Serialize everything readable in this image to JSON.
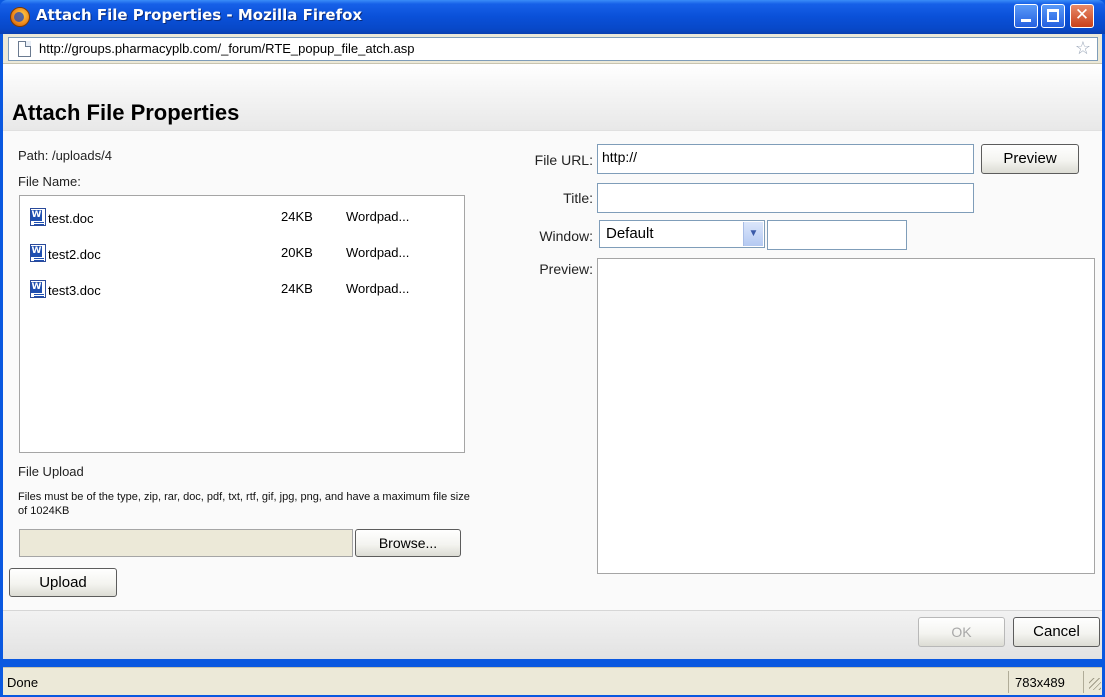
{
  "window": {
    "title": "Attach File Properties - Mozilla Firefox",
    "url": "http://groups.pharmacyplb.com/_forum/RTE_popup_file_atch.asp",
    "close_glyph": "✕"
  },
  "page": {
    "title": "Attach File Properties",
    "path_label": "Path: /uploads/4",
    "file_name_label": "File Name:",
    "files": [
      {
        "name": "test.doc",
        "size": "24KB",
        "type": "Wordpad..."
      },
      {
        "name": "test2.doc",
        "size": "20KB",
        "type": "Wordpad..."
      },
      {
        "name": "test3.doc",
        "size": "24KB",
        "type": "Wordpad..."
      }
    ],
    "file_upload_label": "File Upload",
    "upload_note": "Files must be of the type, zip, rar, doc, pdf, txt, rtf, gif, jpg, png, and have a maximum file size of 1024KB",
    "browse_label": "Browse...",
    "upload_label": "Upload"
  },
  "form": {
    "file_url_label": "File URL:",
    "file_url_value": "http://",
    "preview_button": "Preview",
    "title_label": "Title:",
    "title_value": "",
    "window_label": "Window:",
    "window_value": "Default",
    "window_target_value": "",
    "preview_label": "Preview:"
  },
  "footer": {
    "ok_label": "OK",
    "cancel_label": "Cancel"
  },
  "status": {
    "text": "Done",
    "dimensions": "783x489"
  },
  "icons": {
    "app": "firefox-icon",
    "file": "word-document-icon",
    "bookmark": "star-icon"
  }
}
